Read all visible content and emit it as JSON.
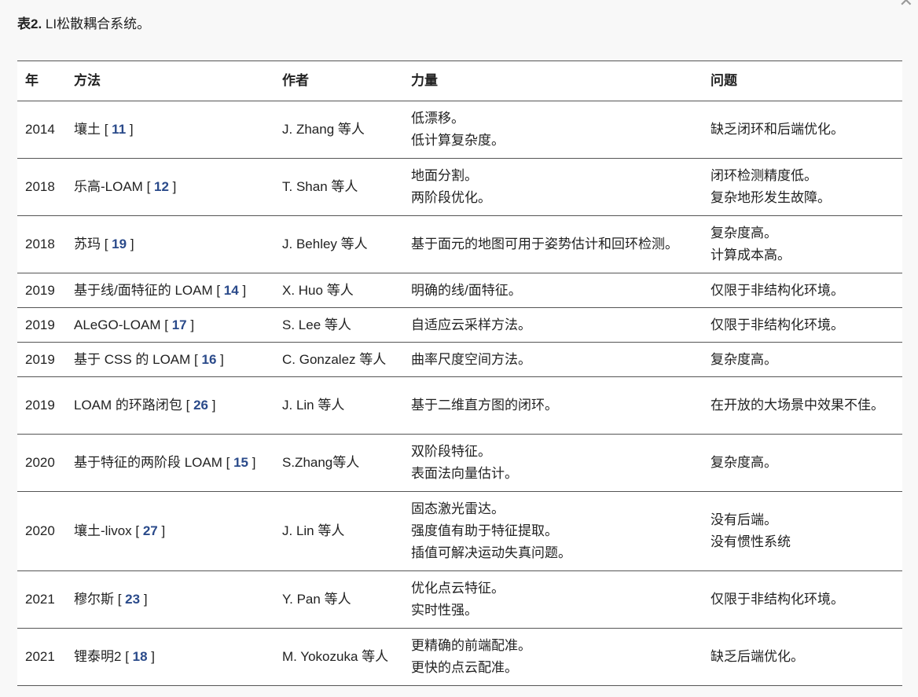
{
  "caption": {
    "label": "表2.",
    "text": " LI松散耦合系统。"
  },
  "table": {
    "headers": [
      "年",
      "方法",
      "作者",
      "力量",
      "问题"
    ],
    "rows": [
      {
        "year": "2014",
        "method": "壤土",
        "ref": "11",
        "author": "J. Zhang 等人",
        "strengths": [
          "低漂移。",
          "低计算复杂度。"
        ],
        "problems": [
          "缺乏闭环和后端优化。"
        ],
        "h": "h2"
      },
      {
        "year": "2018",
        "method": "乐高-LOAM",
        "ref": "12",
        "author": "T. Shan 等人",
        "strengths": [
          "地面分割。",
          "两阶段优化。"
        ],
        "problems": [
          "闭环检测精度低。",
          "复杂地形发生故障。"
        ],
        "h": "h2"
      },
      {
        "year": "2018",
        "method": "苏玛",
        "ref": "19",
        "author": "J. Behley 等人",
        "strengths": [
          "基于面元的地图可用于姿势估计和回环检测。"
        ],
        "problems": [
          "复杂度高。",
          "计算成本高。"
        ],
        "h": "h2"
      },
      {
        "year": "2019",
        "method": "基于线/面特征的 LOAM",
        "ref": "14",
        "author": "X. Huo 等人",
        "strengths": [
          "明确的线/面特征。"
        ],
        "problems": [
          "仅限于非结构化环境。"
        ],
        "h": "h1"
      },
      {
        "year": "2019",
        "method": "ALeGO-LOAM",
        "ref": "17",
        "author": "S. Lee 等人",
        "strengths": [
          "自适应云采样方法。"
        ],
        "problems": [
          "仅限于非结构化环境。"
        ],
        "h": "h1"
      },
      {
        "year": "2019",
        "method": "基于 CSS 的 LOAM",
        "ref": "16",
        "author": "C. Gonzalez 等人",
        "strengths": [
          "曲率尺度空间方法。"
        ],
        "problems": [
          "复杂度高。"
        ],
        "h": "h1"
      },
      {
        "year": "2019",
        "method": "LOAM 的环路闭包",
        "ref": "26",
        "author": "J. Lin 等人",
        "strengths": [
          "基于二维直方图的闭环。"
        ],
        "problems": [
          "在开放的大场景中效果不佳。"
        ],
        "h": "h2"
      },
      {
        "year": "2020",
        "method": "基于特征的两阶段 LOAM",
        "ref": "15",
        "author": "S.Zhang等人",
        "strengths": [
          "双阶段特征。",
          "表面法向量估计。"
        ],
        "problems": [
          "复杂度高。"
        ],
        "h": "h2"
      },
      {
        "year": "2020",
        "method": "壤土-livox",
        "ref": "27",
        "author": "J. Lin 等人",
        "strengths": [
          "固态激光雷达。",
          "强度值有助于特征提取。",
          "插值可解决运动失真问题。"
        ],
        "problems": [
          "没有后端。",
          "没有惯性系统"
        ],
        "h": "h3"
      },
      {
        "year": "2021",
        "method": "穆尔斯",
        "ref": "23",
        "author": "Y. Pan 等人",
        "strengths": [
          "优化点云特征。",
          "实时性强。"
        ],
        "problems": [
          "仅限于非结构化环境。"
        ],
        "h": "h2"
      },
      {
        "year": "2021",
        "method": "锂泰明2",
        "ref": "18",
        "author": "M. Yokozuka 等人",
        "strengths": [
          "更精确的前端配准。",
          "更快的点云配准。"
        ],
        "problems": [
          "缺乏后端优化。"
        ],
        "h": "h2"
      }
    ]
  }
}
